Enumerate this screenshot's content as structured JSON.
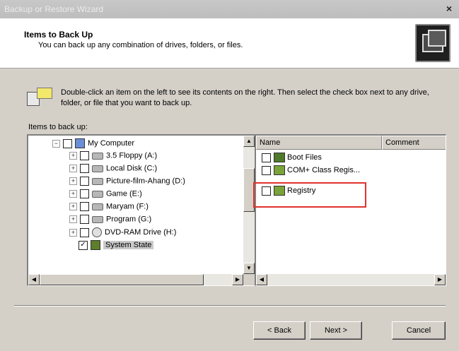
{
  "window": {
    "title": "Backup or Restore Wizard",
    "close_glyph": "×"
  },
  "header": {
    "title": "Items to Back Up",
    "subtitle": "You can back up any combination of drives, folders, or files."
  },
  "instructions": "Double-click an item on the left to see its contents on the right. Then select the check box next to any drive, folder, or file that you want to back up.",
  "left_label": "Items to back up:",
  "tree": [
    {
      "label": "My Computer",
      "expanded": true,
      "checked": false,
      "icon": "computer-icon"
    },
    {
      "label": "3.5 Floppy (A:)",
      "checked": false,
      "icon": "floppy-drive-icon"
    },
    {
      "label": "Local Disk (C:)",
      "checked": false,
      "icon": "disk-drive-icon"
    },
    {
      "label": "Picture-film-Ahang (D:)",
      "checked": false,
      "icon": "disk-drive-icon"
    },
    {
      "label": "Game (E:)",
      "checked": false,
      "icon": "disk-drive-icon"
    },
    {
      "label": "Maryam (F:)",
      "checked": false,
      "icon": "disk-drive-icon"
    },
    {
      "label": "Program (G:)",
      "checked": false,
      "icon": "disk-drive-icon"
    },
    {
      "label": "DVD-RAM Drive (H:)",
      "checked": false,
      "icon": "dvd-drive-icon"
    },
    {
      "label": "System State",
      "checked": true,
      "selected": true,
      "icon": "system-state-icon"
    }
  ],
  "list": {
    "columns": [
      "Name",
      "Comment"
    ],
    "rows": [
      {
        "name": "Boot Files",
        "checked": false
      },
      {
        "name": "COM+ Class Regis...",
        "checked": false
      },
      {
        "name": "Registry",
        "checked": false,
        "highlighted": true
      }
    ]
  },
  "buttons": {
    "back": "< Back",
    "next": "Next >",
    "cancel": "Cancel"
  },
  "colors": {
    "highlight": "#e0322c",
    "dialog_bg": "#d4d0c8"
  }
}
